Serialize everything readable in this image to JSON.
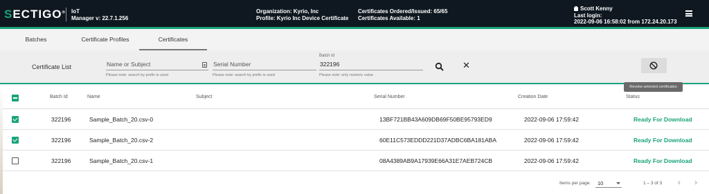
{
  "header": {
    "logo": "SECTIGO",
    "app_name": "IoT",
    "app_version": "Manager v: 22.7.1.256",
    "organization": "Organization: Kyrio, Inc",
    "profile": "Profile: Kyrio Inc Device Certificate",
    "certs_ordered": "Certificates Ordered/Issued: 65/65",
    "certs_available": "Certificates Available: 1",
    "user_name": "Scott Kenny",
    "last_login_label": "Last login:",
    "last_login_value": "2022-09-06 16:58:02 from 172.24.20.173"
  },
  "tabs": [
    {
      "label": "Batches"
    },
    {
      "label": "Certificate Profiles"
    },
    {
      "label": "Certificates",
      "active": true
    }
  ],
  "filter": {
    "title": "Certificate List",
    "name_placeholder": "Name or Subject",
    "name_hint": "Please note: search by prefix is used",
    "serial_placeholder": "Serial Number",
    "serial_hint": "Please note: search by prefix is used",
    "batch_label": "Batch Id",
    "batch_value": "322196",
    "batch_hint": "Please note: only numeric value",
    "revoke_tooltip": "Revoke selected certificates"
  },
  "table": {
    "columns": [
      "Batch Id",
      "Name",
      "Subject",
      "Serial Number",
      "Creation Date",
      "Status"
    ],
    "rows": [
      {
        "checked": true,
        "batch": "322196",
        "name": "Sample_Batch_20.csv-0",
        "subject": "",
        "serial": "13BF721BB43A609DB69F50BE95793ED9",
        "date": "2022-09-06 17:59:42",
        "status": "Ready For Download"
      },
      {
        "checked": true,
        "batch": "322196",
        "name": "Sample_Batch_20.csv-2",
        "subject": "",
        "serial": "60E11C573EDDD221D37ADBC6BA181ABA",
        "date": "2022-09-06 17:59:42",
        "status": "Ready For Download"
      },
      {
        "checked": false,
        "batch": "322196",
        "name": "Sample_Batch_20.csv-1",
        "subject": "",
        "serial": "08A4389AB9A17939E66A31E7AEB724CB",
        "date": "2022-09-06 17:59:42",
        "status": "Ready For Download"
      }
    ]
  },
  "paginator": {
    "items_per_page_label": "Items per page:",
    "items_per_page": "10",
    "range": "1 – 3 of 3"
  },
  "colors": {
    "accent": "#1aa37a",
    "header_bg": "#0f1820"
  }
}
